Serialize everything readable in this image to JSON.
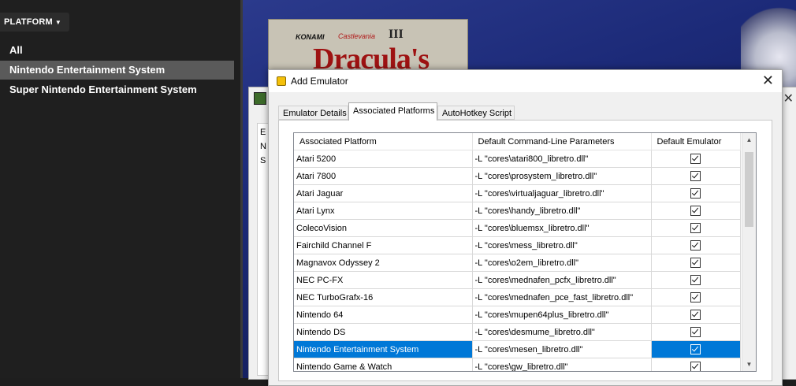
{
  "left_panel": {
    "platform_button": "PLATFORM",
    "items": [
      {
        "label": "All",
        "selected": false
      },
      {
        "label": "Nintendo Entertainment System",
        "selected": true
      },
      {
        "label": "Super Nintendo Entertainment System",
        "selected": false
      }
    ]
  },
  "background_art": {
    "publisher": "KONAMI",
    "series": "Castlevania",
    "roman": "III",
    "title_fragment": "Dracula's"
  },
  "back_window": {
    "letters": [
      "E",
      "N",
      "S"
    ]
  },
  "dialog": {
    "title": "Add Emulator",
    "tabs": [
      "Emulator Details",
      "Associated Platforms",
      "AutoHotkey Script"
    ],
    "active_tab": "Associated Platforms",
    "columns": [
      "Associated Platform",
      "Default Command-Line Parameters",
      "Default Emulator"
    ],
    "rows": [
      {
        "platform": "Atari 5200",
        "params": "-L \"cores\\atari800_libretro.dll\"",
        "default": true
      },
      {
        "platform": "Atari 7800",
        "params": "-L \"cores\\prosystem_libretro.dll\"",
        "default": true
      },
      {
        "platform": "Atari Jaguar",
        "params": "-L \"cores\\virtualjaguar_libretro.dll\"",
        "default": true
      },
      {
        "platform": "Atari Lynx",
        "params": "-L \"cores\\handy_libretro.dll\"",
        "default": true
      },
      {
        "platform": "ColecoVision",
        "params": "-L \"cores\\bluemsx_libretro.dll\"",
        "default": true
      },
      {
        "platform": "Fairchild Channel F",
        "params": "-L \"cores\\mess_libretro.dll\"",
        "default": true
      },
      {
        "platform": "Magnavox Odyssey 2",
        "params": "-L \"cores\\o2em_libretro.dll\"",
        "default": true
      },
      {
        "platform": "NEC PC-FX",
        "params": "-L \"cores\\mednafen_pcfx_libretro.dll\"",
        "default": true
      },
      {
        "platform": "NEC TurboGrafx-16",
        "params": "-L \"cores\\mednafen_pce_fast_libretro.dll\"",
        "default": true
      },
      {
        "platform": "Nintendo 64",
        "params": "-L \"cores\\mupen64plus_libretro.dll\"",
        "default": true
      },
      {
        "platform": "Nintendo DS",
        "params": "-L \"cores\\desmume_libretro.dll\"",
        "default": true
      },
      {
        "platform": "Nintendo Entertainment System",
        "params": "-L \"cores\\mesen_libretro.dll\"",
        "default": true,
        "selected": true
      },
      {
        "platform": "Nintendo Game & Watch",
        "params": "-L \"cores\\gw_libretro.dll\"",
        "default": true
      }
    ]
  },
  "colors": {
    "selection_blue": "#0078d7",
    "sidebar_bg": "#1f1f1f",
    "sidebar_selected": "#5a5a5a"
  }
}
